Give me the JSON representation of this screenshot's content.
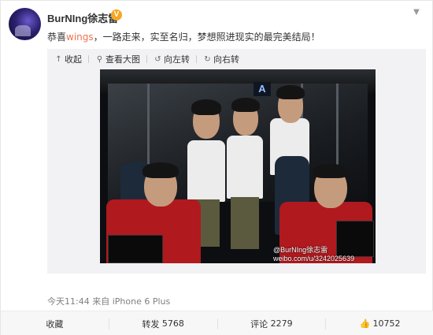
{
  "user": {
    "name": "BurNIng徐志雷",
    "verified_badge": "V"
  },
  "post": {
    "text_prefix": "恭喜",
    "mention": "wings",
    "text_suffix": "，一路走来，实至名归，梦想照进现实的最完美结局！"
  },
  "media_toolbar": {
    "collapse": "收起",
    "view_large": "查看大图",
    "rotate_left": "向左转",
    "rotate_right": "向右转"
  },
  "photo": {
    "sign_letter": "A",
    "watermark_line1": "@BurNIng徐志雷",
    "watermark_line2": "weibo.com/u/3242025639"
  },
  "meta": {
    "time": "今天11:44",
    "source_prefix": "来自",
    "source": "iPhone 6 Plus"
  },
  "actions": {
    "favorite": "收藏",
    "repost_label": "转发",
    "repost_count": "5768",
    "comment_label": "评论",
    "comment_count": "2279",
    "like_count": "10752"
  },
  "colors": {
    "mention": "#eb7350",
    "badge": "#f6a623",
    "muted": "#808080"
  }
}
